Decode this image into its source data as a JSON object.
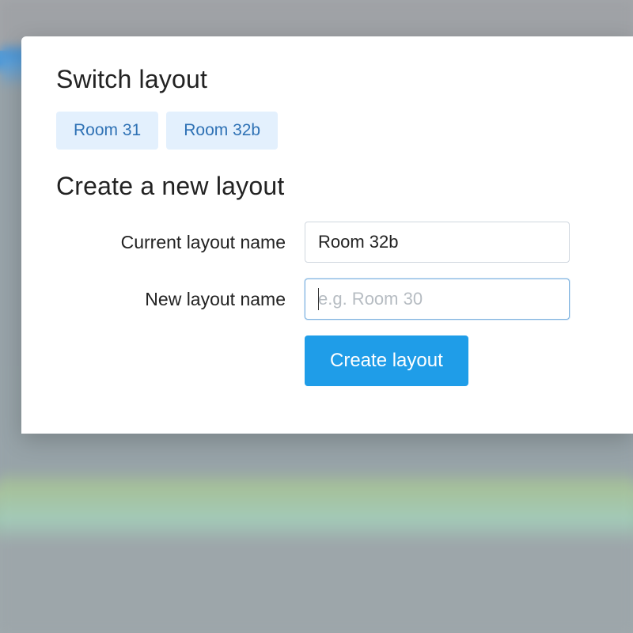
{
  "switch": {
    "title": "Switch layout",
    "layouts": [
      "Room 31",
      "Room 32b"
    ]
  },
  "create": {
    "title": "Create a new layout",
    "current_label": "Current layout name",
    "current_value": "Room 32b",
    "new_label": "New layout name",
    "new_placeholder": "e.g. Room 30",
    "button_label": "Create layout"
  }
}
